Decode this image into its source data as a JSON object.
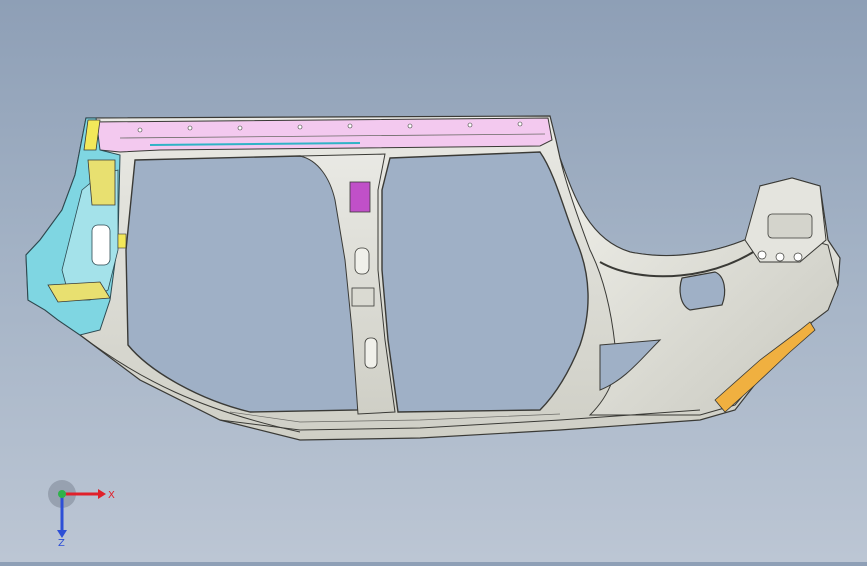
{
  "viewport": {
    "background_top": "#8e9fb6",
    "background_bottom": "#bcc6d4",
    "model": "side-body-panel-assembly"
  },
  "triad": {
    "x_label": "X",
    "z_label": "Z",
    "x_color": "#e0202a",
    "y_color": "#2fb24a",
    "z_color": "#2d4fd6"
  }
}
